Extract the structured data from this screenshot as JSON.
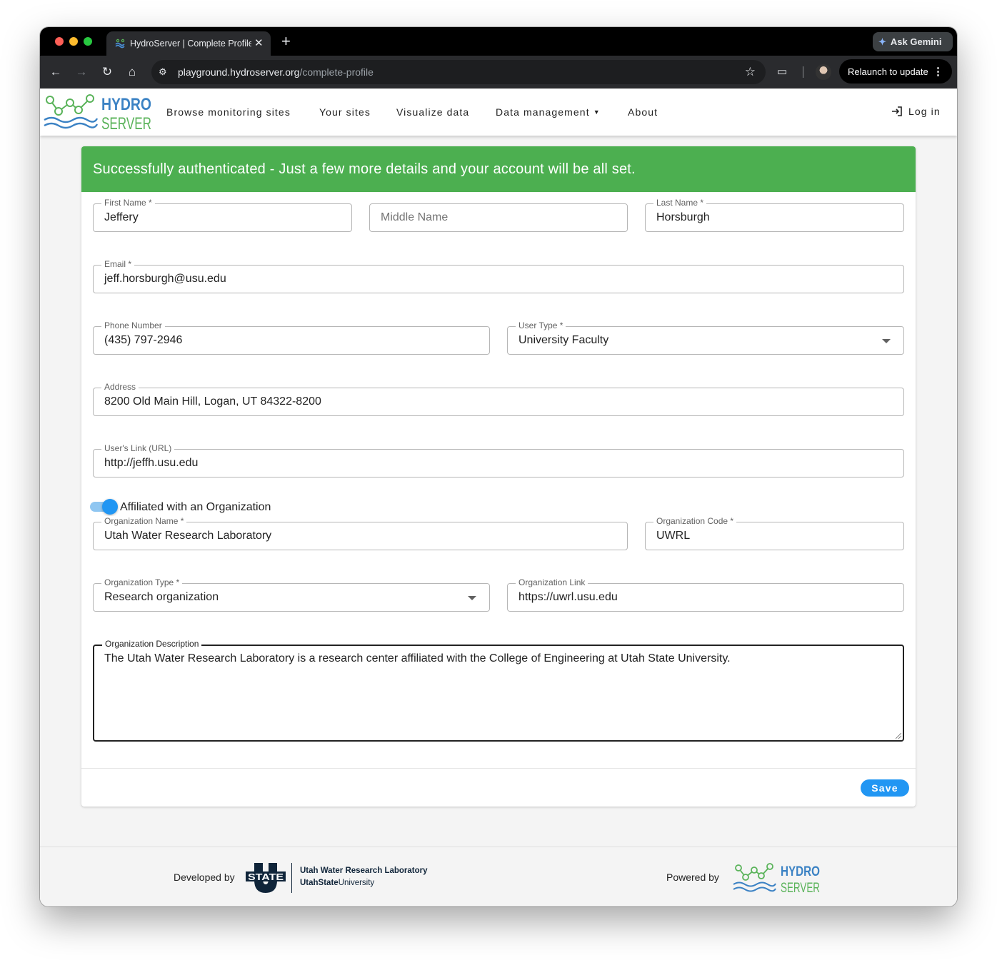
{
  "browser": {
    "tab_title": "HydroServer | Complete Profile",
    "gemini_label": "Ask Gemini",
    "url_host": "playground.hydroserver.org",
    "url_path": "/complete-profile",
    "relaunch_label": "Relaunch to update"
  },
  "header": {
    "logo_line1": "HYDRO",
    "logo_line2": "SERVER",
    "nav": [
      "Browse monitoring sites",
      "Your sites",
      "Visualize data",
      "Data management",
      "About"
    ],
    "login_label": "Log in"
  },
  "banner_text": "Successfully authenticated - Just a few more details and your account will be all set.",
  "form": {
    "first_name": {
      "label": "First Name *",
      "value": "Jeffery"
    },
    "middle_name": {
      "placeholder": "Middle Name"
    },
    "last_name": {
      "label": "Last Name *",
      "value": "Horsburgh"
    },
    "email": {
      "label": "Email *",
      "value": "jeff.horsburgh@usu.edu"
    },
    "phone": {
      "label": "Phone Number",
      "value": "(435) 797-2946"
    },
    "user_type": {
      "label": "User Type *",
      "value": "University Faculty"
    },
    "address": {
      "label": "Address",
      "value": "8200 Old Main Hill, Logan, UT 84322-8200"
    },
    "user_link": {
      "label": "User's Link (URL)",
      "value": "http://jeffh.usu.edu"
    },
    "affiliated": {
      "label": "Affiliated with an Organization",
      "on": true
    },
    "org_name": {
      "label": "Organization Name *",
      "value": "Utah Water Research Laboratory"
    },
    "org_code": {
      "label": "Organization Code *",
      "value": "UWRL"
    },
    "org_type": {
      "label": "Organization Type *",
      "value": "Research organization"
    },
    "org_link": {
      "label": "Organization Link",
      "value": "https://uwrl.usu.edu"
    },
    "org_description": {
      "label": "Organization Description",
      "value": "The Utah Water Research Laboratory is a research center affiliated with the College of Engineering at Utah State University."
    },
    "save_label": "Save"
  },
  "footer": {
    "developed_by": "Developed by",
    "usu_logo_text": "STATE",
    "usu_line1": "Utah Water Research Laboratory",
    "usu_line2_bold": "UtahState",
    "usu_line2_rest": "University",
    "powered_by": "Powered by",
    "logo_line1": "HYDRO",
    "logo_line2": "SERVER"
  },
  "colors": {
    "banner_green": "#4caf50",
    "primary_blue": "#2196f3",
    "logo_blue": "#3b82c4",
    "logo_green": "#5ab35a"
  }
}
